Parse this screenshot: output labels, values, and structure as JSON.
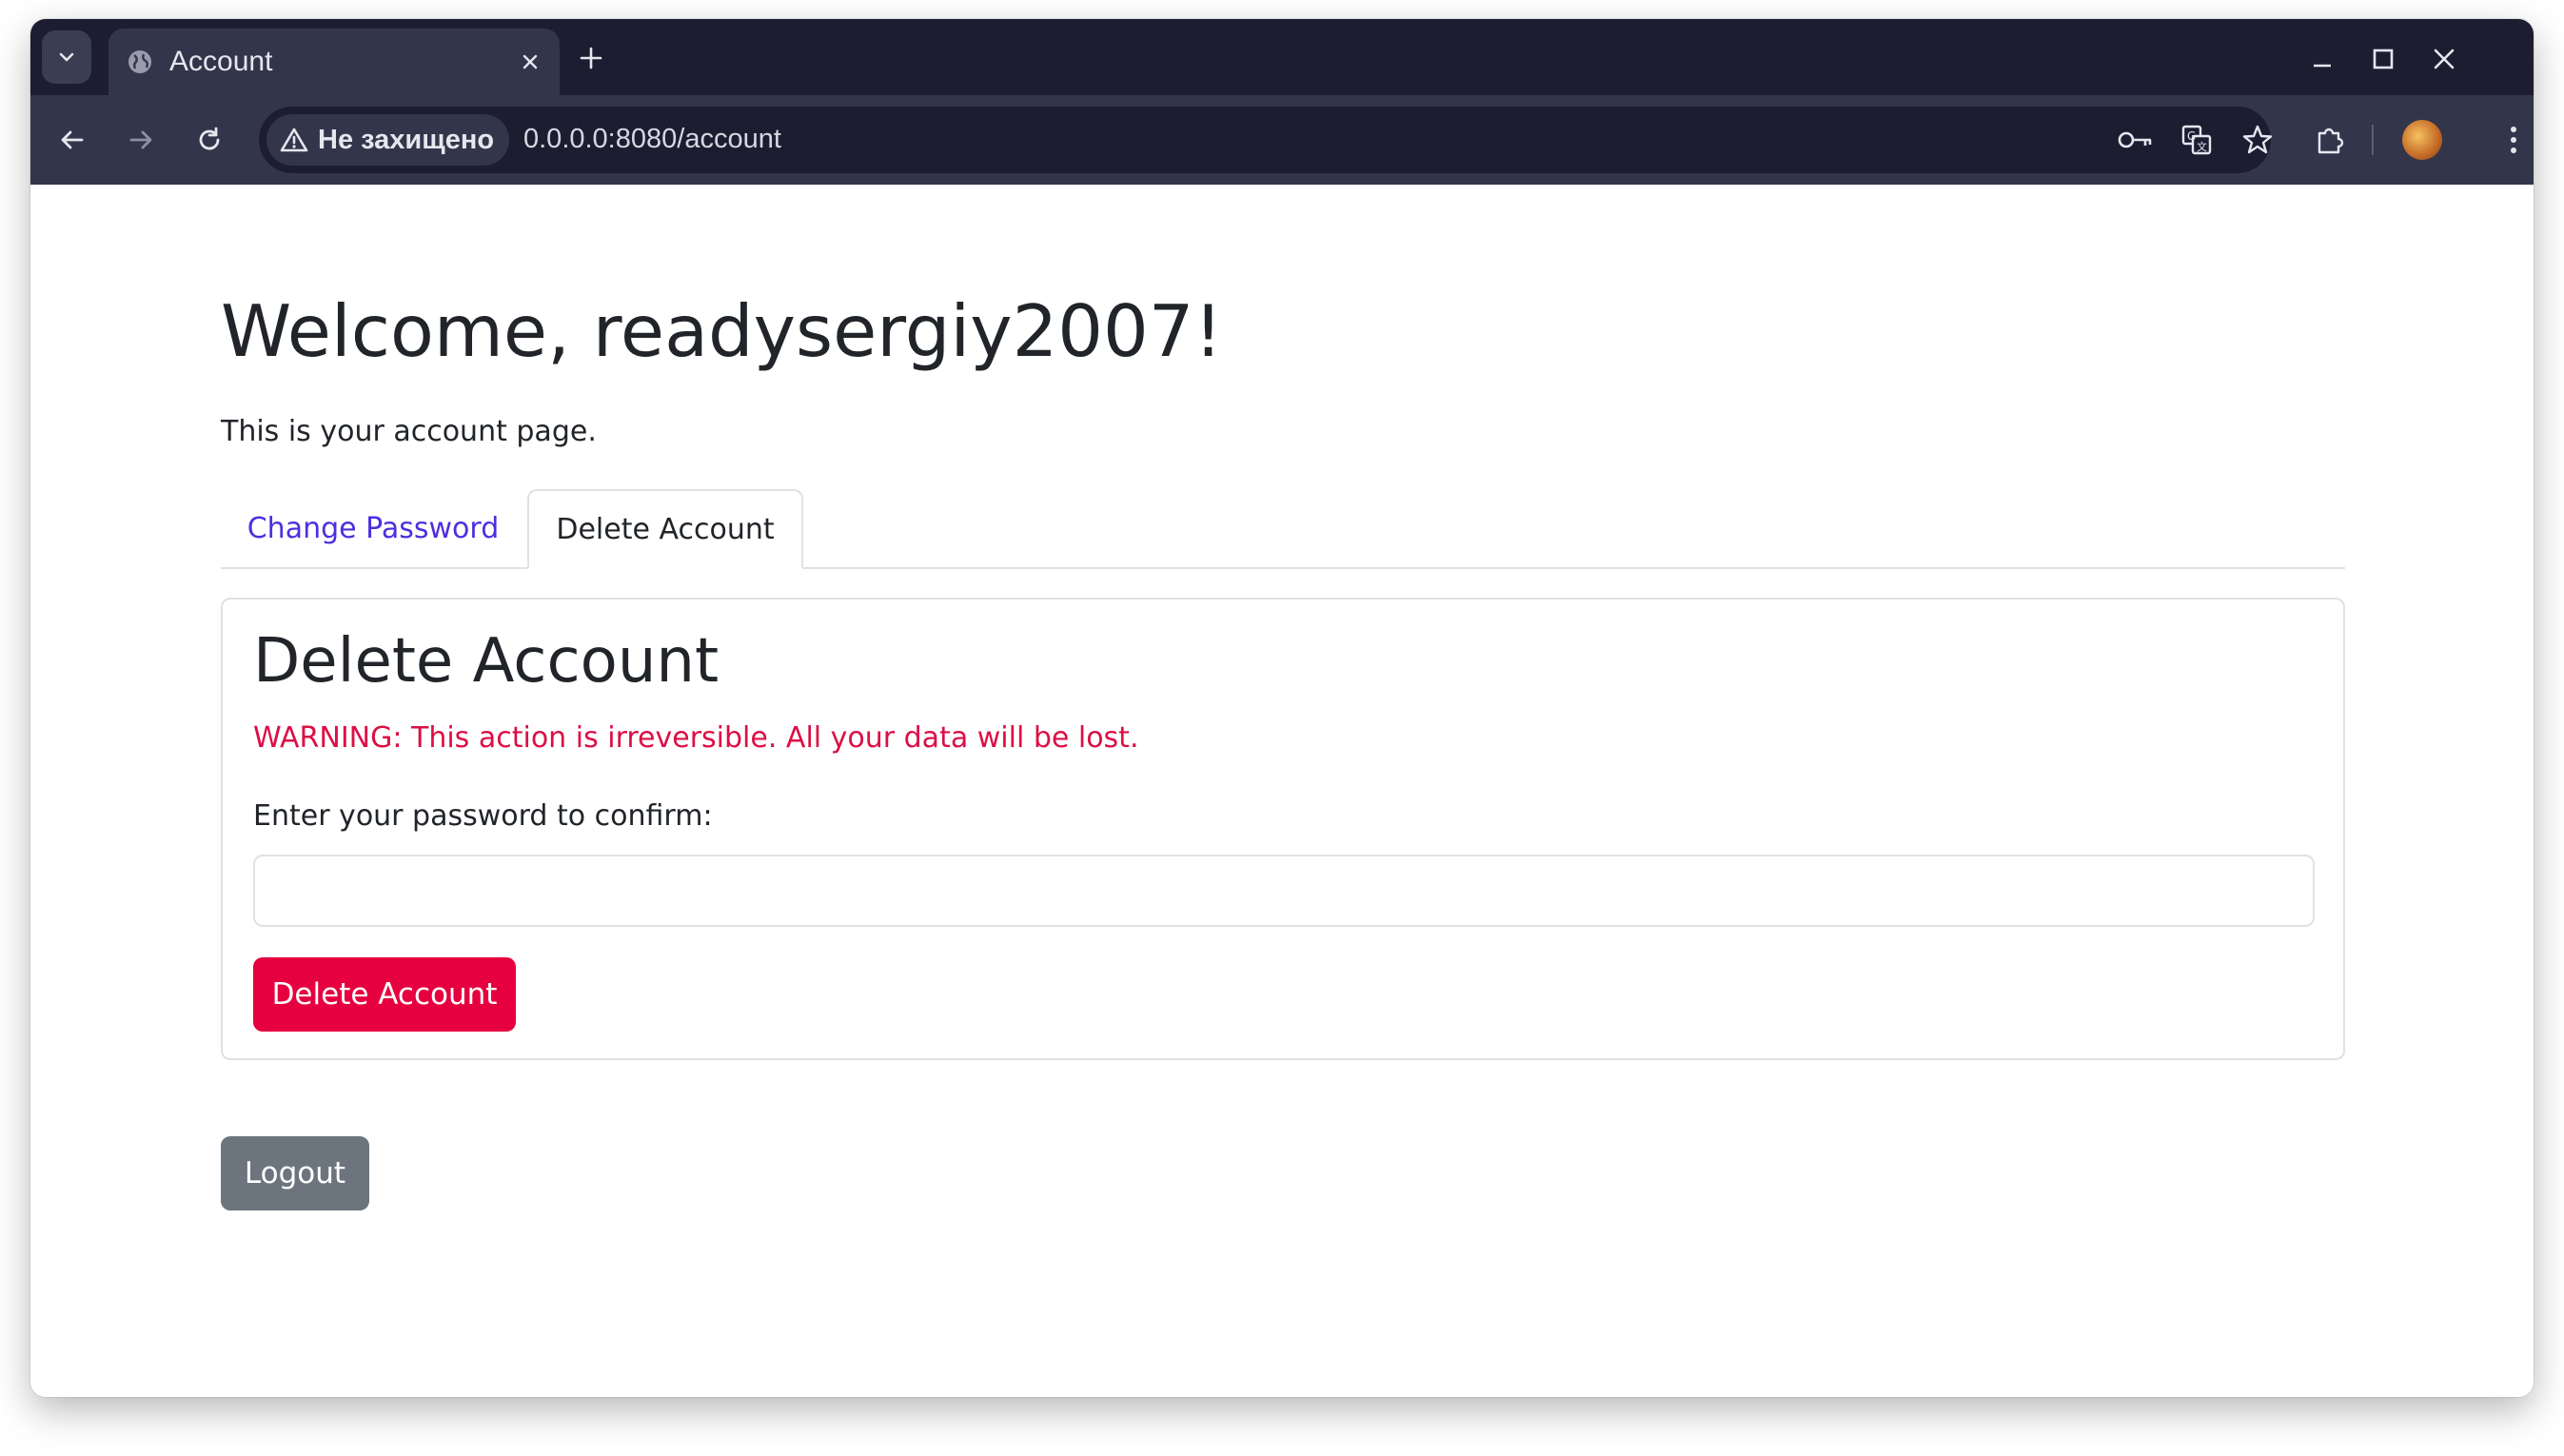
{
  "browser": {
    "tab_title": "Account",
    "security_label": "Не захищено",
    "url": "0.0.0.0:8080/account"
  },
  "page": {
    "heading": "Welcome, readysergiy2007!",
    "intro": "This is your account page.",
    "tabs": [
      {
        "label": "Change Password",
        "active": false
      },
      {
        "label": "Delete Account",
        "active": true
      }
    ]
  },
  "delete_section": {
    "title": "Delete Account",
    "warning": "WARNING: This action is irreversible. All your data will be lost.",
    "password_label": "Enter your password to confirm:",
    "password_value": "",
    "button_label": "Delete Account"
  },
  "logout_label": "Logout",
  "colors": {
    "link": "#4e2ee0",
    "danger": "#e6003f",
    "warning_text": "#dc0f45",
    "secondary": "#6c757d",
    "browser_frame": "#1c1d31"
  }
}
